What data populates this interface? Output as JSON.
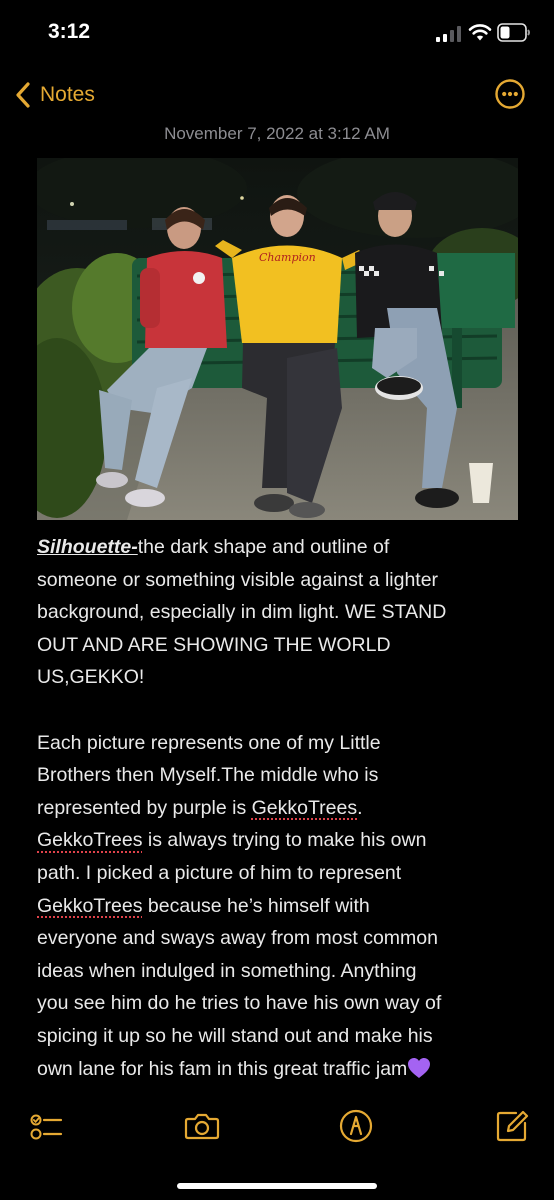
{
  "status_bar": {
    "time": "3:12"
  },
  "nav": {
    "back_label": "Notes",
    "accent_color": "#e5a933"
  },
  "note": {
    "date": "November 7, 2022 at 3:12 AM",
    "term": "Silhouette-",
    "definition_lines": [
      "the dark shape and outline of",
      "someone or something visible against a lighter",
      "background, especially in dim light. WE STAND",
      "OUT AND ARE SHOWING THE WORLD",
      "US,GEKKO!"
    ],
    "paragraph2": {
      "l1": "Each picture represents one of my Little",
      "l2": "Brothers then Myself.The middle who is",
      "l3a": "represented by purple is ",
      "l3b": "GekkoTrees",
      "l3c": ".",
      "l4a": "GekkoTrees",
      "l4b": " is always trying to make his own",
      "l5": "path. I picked a picture of him to represent",
      "l6a": "GekkoTrees",
      "l6b": " because he’s himself with",
      "l7": "everyone and sways away from most common",
      "l8": "ideas when indulged in something. Anything",
      "l9": "you see him do he tries to have his own way of",
      "l10": "spicing it up so he will stand out and make his",
      "l11": "own lane for his fam in this great traffic jam"
    },
    "heart_color": "#a463f2"
  },
  "toolbar": {
    "icons": [
      "checklist-icon",
      "camera-icon",
      "markup-icon",
      "compose-icon"
    ]
  }
}
